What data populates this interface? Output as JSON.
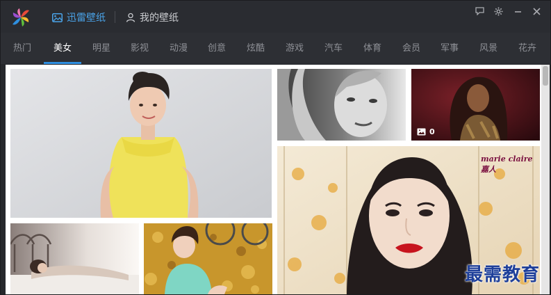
{
  "app": {
    "title": "迅雷壁纸",
    "tab_my": "我的壁纸"
  },
  "window_controls": [
    "feedback-icon",
    "gear-icon",
    "minimize-icon",
    "close-icon"
  ],
  "categories": [
    "热门",
    "美女",
    "明星",
    "影视",
    "动漫",
    "创意",
    "炫酷",
    "游戏",
    "汽车",
    "体育",
    "会员",
    "军事",
    "风景",
    "花卉"
  ],
  "active_category": "美女",
  "tiles": [
    {
      "name": "woman-yellow-dress",
      "alt": "woman in yellow dress",
      "image_count": ""
    },
    {
      "name": "woman-bw-portrait",
      "alt": "black and white portrait",
      "image_count": ""
    },
    {
      "name": "woman-dark-red",
      "alt": "woman on dark red background",
      "image_count": "0"
    },
    {
      "name": "woman-magazine-cover",
      "alt": "magazine cover portrait",
      "image_count": ""
    },
    {
      "name": "woman-on-bed",
      "alt": "woman lying on bed",
      "image_count": ""
    },
    {
      "name": "woman-autumn-leaves",
      "alt": "woman sitting on autumn leaves",
      "image_count": ""
    }
  ],
  "magazine_mark": "marie claire 嘉人",
  "watermark": "最需教育",
  "colors": {
    "accent": "#2f8fe0",
    "titlebar": "#2a2c31",
    "catbar": "#2d2f34"
  }
}
